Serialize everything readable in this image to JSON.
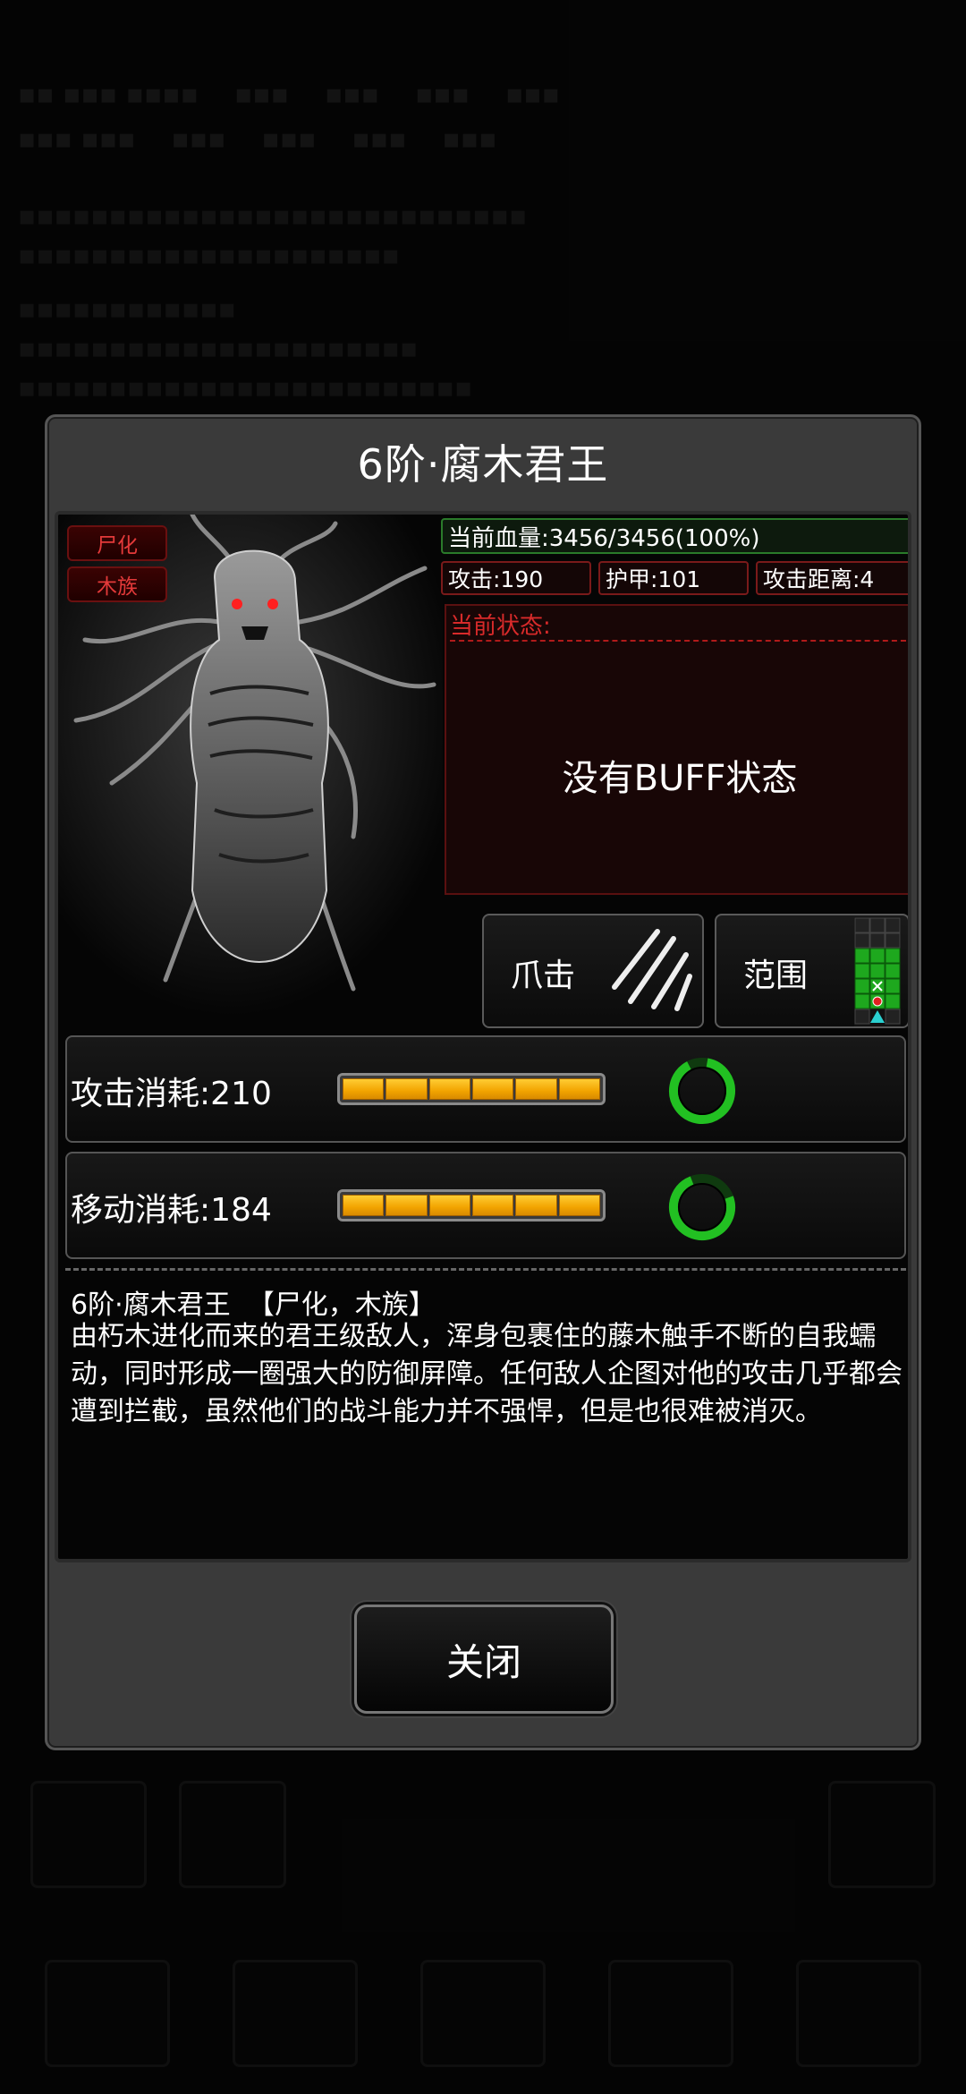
{
  "dialog": {
    "title": "6阶·腐木君王",
    "tags": [
      "尸化",
      "木族"
    ],
    "hp": "当前血量:3456/3456(100%)",
    "attack": "攻击:190",
    "armor": "护甲:101",
    "range": "攻击距离:4",
    "state_label": "当前状态:",
    "state_text": "没有BUFF状态",
    "skills": [
      {
        "label": "爪击",
        "icon": "claw-icon"
      },
      {
        "label": "范围",
        "icon": "range-grid-icon"
      }
    ],
    "costs": [
      {
        "label": "攻击消耗:210",
        "level": 1.0
      },
      {
        "label": "移动消耗:184",
        "level": 1.0
      }
    ],
    "desc_title": "6阶·腐木君王  【尸化，木族】",
    "desc_body": "由朽木进化而来的君王级敌人，浑身包裹住的藤木触手不断的自我蠕动，同时形成一圈强大的防御屏障。任何敌人企图对他的攻击几乎都会遭到拦截，虽然他们的战斗能力并不强悍，但是也很难被消灭。",
    "close_label": "关闭"
  },
  "colors": {
    "accent_red": "#d82a2a",
    "hp_green": "#2a7a2a",
    "bar_gold": "#f2a400",
    "ring_green": "#22c022"
  }
}
